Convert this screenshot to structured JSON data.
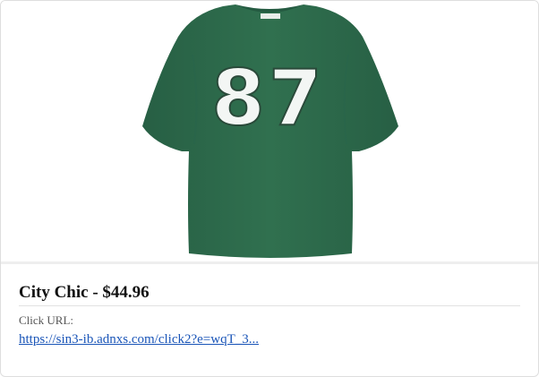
{
  "product": {
    "title": "City Chic - $44.96",
    "image_alt": "Green t-shirt with number 87",
    "shirt_number": "87",
    "shirt_color": "#2f6e50",
    "number_fill": "#f3f6f4"
  },
  "click": {
    "label": "Click URL:",
    "url_text": "https://sin3-ib.adnxs.com/click2?e=wqT_3..."
  },
  "colors": {
    "link": "#1a55b8",
    "border": "#dedede"
  }
}
